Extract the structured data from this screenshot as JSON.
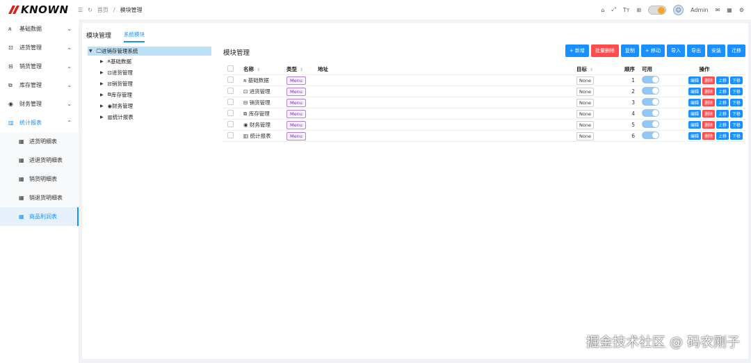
{
  "header": {
    "logo_text": "KNOWN",
    "menu_icon": "menu-icon",
    "reload_icon": "refresh-icon",
    "breadcrumb_home": "首页",
    "breadcrumb_sep": "/",
    "breadcrumb_current": "模块管理",
    "user_name": "Admin",
    "right_icons": [
      "home-icon",
      "fullscreen-icon",
      "font-size-icon",
      "layout-icon",
      "theme-toggle",
      "user-avatar",
      "mail-icon",
      "grid-icon",
      "settings-icon"
    ]
  },
  "sidebar": {
    "items": [
      {
        "label": "基础数据",
        "icon": "user-icon"
      },
      {
        "label": "进货管理",
        "icon": "inbound-icon"
      },
      {
        "label": "销货管理",
        "icon": "outbound-icon"
      },
      {
        "label": "库存管理",
        "icon": "inventory-icon"
      },
      {
        "label": "财务管理",
        "icon": "finance-icon"
      },
      {
        "label": "统计报表",
        "icon": "chart-icon"
      }
    ],
    "sub_items": [
      {
        "label": "进货明细表"
      },
      {
        "label": "进退货明细表"
      },
      {
        "label": "销货明细表"
      },
      {
        "label": "销退货明细表"
      },
      {
        "label": "商品利润表"
      }
    ]
  },
  "main": {
    "tabs": [
      {
        "label": "模块管理"
      },
      {
        "label": "系统模块"
      }
    ],
    "tree": {
      "root": "进销存管理系统",
      "nodes": [
        "基础数据",
        "进货管理",
        "销货管理",
        "库存管理",
        "财务管理",
        "统计报表"
      ]
    },
    "panel_title": "模块管理",
    "buttons": [
      "+ 新增",
      "批量删除",
      "复制",
      "+ 移动",
      "导入",
      "导出",
      "安装",
      "迁移"
    ],
    "columns": [
      "名称",
      "类型",
      "地址",
      "目标",
      "顺序",
      "可用",
      "操作"
    ],
    "rows": [
      {
        "name": "基础数据",
        "type": "Menu",
        "address": "",
        "target": "None",
        "order": "1",
        "enabled": true
      },
      {
        "name": "进货管理",
        "type": "Menu",
        "address": "",
        "target": "None",
        "order": "2",
        "enabled": true
      },
      {
        "name": "销货管理",
        "type": "Menu",
        "address": "",
        "target": "None",
        "order": "3",
        "enabled": true
      },
      {
        "name": "库存管理",
        "type": "Menu",
        "address": "",
        "target": "None",
        "order": "4",
        "enabled": true
      },
      {
        "name": "财务管理",
        "type": "Menu",
        "address": "",
        "target": "None",
        "order": "5",
        "enabled": true
      },
      {
        "name": "统计报表",
        "type": "Menu",
        "address": "",
        "target": "None",
        "order": "6",
        "enabled": true
      }
    ],
    "row_actions": [
      "编辑",
      "删除",
      "上移",
      "下移"
    ]
  },
  "watermark": "掘金技术社区 @ 码农刚子",
  "colors": {
    "primary": "#1890ff",
    "danger": "#ff4d4f",
    "tag": "#722ed1"
  }
}
